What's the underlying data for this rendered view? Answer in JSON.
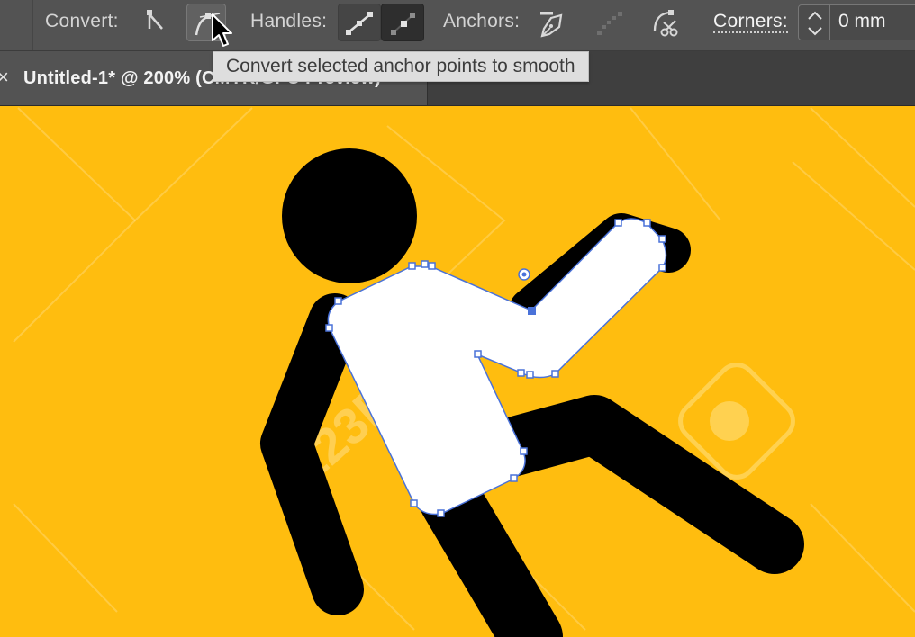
{
  "toolbar": {
    "convert_label": "Convert:",
    "handles_label": "Handles:",
    "anchors_label": "Anchors:",
    "corners_label": "Corners:",
    "corners_value": "0 mm"
  },
  "tooltip": {
    "text": "Convert selected anchor points to smooth"
  },
  "document_tab": {
    "close_symbol": "×",
    "title": "Untitled-1* @ 200% (CMYK/GPU Preview)"
  },
  "canvas": {
    "watermark_text": "123RF",
    "colors": {
      "background": "#ffbd0f",
      "figure": "#000000",
      "selection": "#4a72d9",
      "selected_shape_fill": "#ffffff"
    }
  },
  "icons": {
    "convert_corner": "convert-to-corner-icon",
    "convert_smooth": "convert-to-smooth-icon",
    "show_handles": "show-handles-icon",
    "hide_handles": "hide-handles-icon",
    "remove_anchor": "remove-anchor-pen-icon",
    "connect_endpoints": "connect-endpoints-icon",
    "cut_path": "cut-path-scissors-icon",
    "stepper": "up-down-stepper-icon",
    "cursor": "mouse-pointer-icon"
  }
}
